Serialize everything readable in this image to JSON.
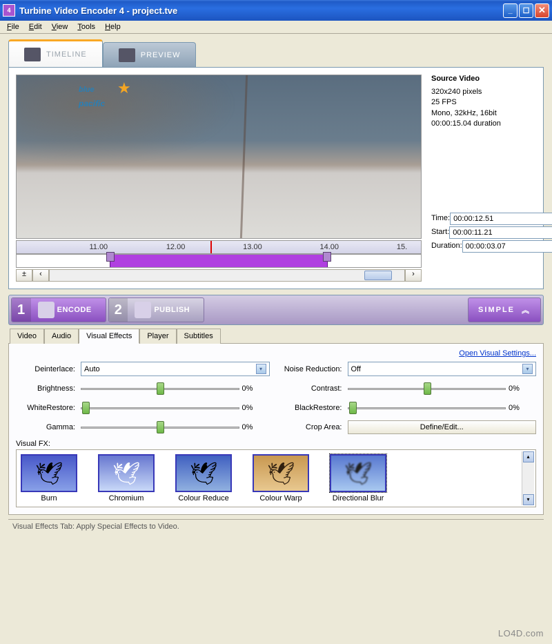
{
  "window": {
    "title": "Turbine Video Encoder 4 - project.tve"
  },
  "menu": {
    "file": "File",
    "edit": "Edit",
    "view": "View",
    "tools": "Tools",
    "help": "Help"
  },
  "tabs": {
    "timeline": "TIMELINE",
    "preview": "PREVIEW"
  },
  "preview": {
    "logo_text": "blue",
    "logo_sub": "pacific"
  },
  "ruler": {
    "t0": "11.00",
    "t1": "12.00",
    "t2": "13.00",
    "t3": "14.00",
    "t4": "15."
  },
  "source": {
    "heading": "Source Video",
    "dims": "320x240 pixels",
    "fps": "25 FPS",
    "audio": "Mono, 32kHz, 16bit",
    "duration": "00:00:15.04 duration"
  },
  "time": {
    "time_label": "Time:",
    "time_val": "00:00:12.51",
    "start_label": "Start:",
    "start_val": "00:00:11.21",
    "dur_label": "Duration:",
    "dur_val": "00:00:03.07"
  },
  "actions": {
    "encode": "ENCODE",
    "publish": "PUBLISH",
    "simple": "SIMPLE",
    "n1": "1",
    "n2": "2"
  },
  "setting_tabs": {
    "video": "Video",
    "audio": "Audio",
    "vfx": "Visual Effects",
    "player": "Player",
    "subs": "Subtitles"
  },
  "link": {
    "open_settings": "Open Visual Settings..."
  },
  "controls": {
    "deinterlace_label": "Deinterlace:",
    "deinterlace_val": "Auto",
    "noise_label": "Noise Reduction:",
    "noise_val": "Off",
    "brightness_label": "Brightness:",
    "brightness_val": "0%",
    "contrast_label": "Contrast:",
    "contrast_val": "0%",
    "white_label": "WhiteRestore:",
    "white_val": "0%",
    "black_label": "BlackRestore:",
    "black_val": "0%",
    "gamma_label": "Gamma:",
    "gamma_val": "0%",
    "crop_label": "Crop Area:",
    "crop_btn": "Define/Edit..."
  },
  "fx": {
    "label": "Visual FX:",
    "items": [
      "Burn",
      "Chromium",
      "Colour Reduce",
      "Colour Warp",
      "Directional Blur"
    ]
  },
  "status": {
    "text": "Visual Effects Tab: Apply Special Effects to Video."
  },
  "watermark": "LO4D.com"
}
